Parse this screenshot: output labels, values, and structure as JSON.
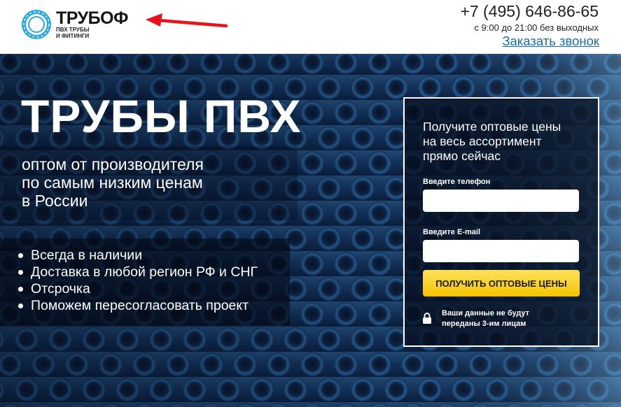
{
  "logo": {
    "name": "ТРУБОФ",
    "tagline_1": "ПВХ ТРУБЫ",
    "tagline_2": "И ФИТИНГИ"
  },
  "contact": {
    "phone": "+7 (495) 646-86-65",
    "hours": "с 9:00 до 21:00 без выходных",
    "callback": "Заказать звонок"
  },
  "hero": {
    "title": "ТРУБЫ ПВХ",
    "subtitle": [
      "оптом от производителя",
      "по самым низким ценам",
      "в России"
    ],
    "bullets": [
      "Всегда в наличии",
      "Доставка в любой регион РФ и СНГ",
      "Отсрочка",
      "Поможем пересогласовать проект"
    ]
  },
  "form": {
    "title": [
      "Получите оптовые цены",
      "на весь ассортимент",
      "прямо сейчас"
    ],
    "phone_label": "Введите телефон",
    "phone_value": "",
    "email_label": "Введите E-mail",
    "email_value": "",
    "submit": "ПОЛУЧИТЬ ОПТОВЫЕ ЦЕНЫ",
    "privacy": [
      "Ваши данные не будут",
      "переданы 3-им лицам"
    ]
  },
  "colors": {
    "accent_button": "#f5c400",
    "link": "#1a6ea8",
    "logo_ring": "#29a9e1",
    "annotation_arrow": "#e8141b",
    "hero_background": "#0b1830"
  },
  "icons": [
    "logo-ring-icon",
    "red-arrow-annotation-icon",
    "lock-icon",
    "bullet-dot-icon"
  ]
}
